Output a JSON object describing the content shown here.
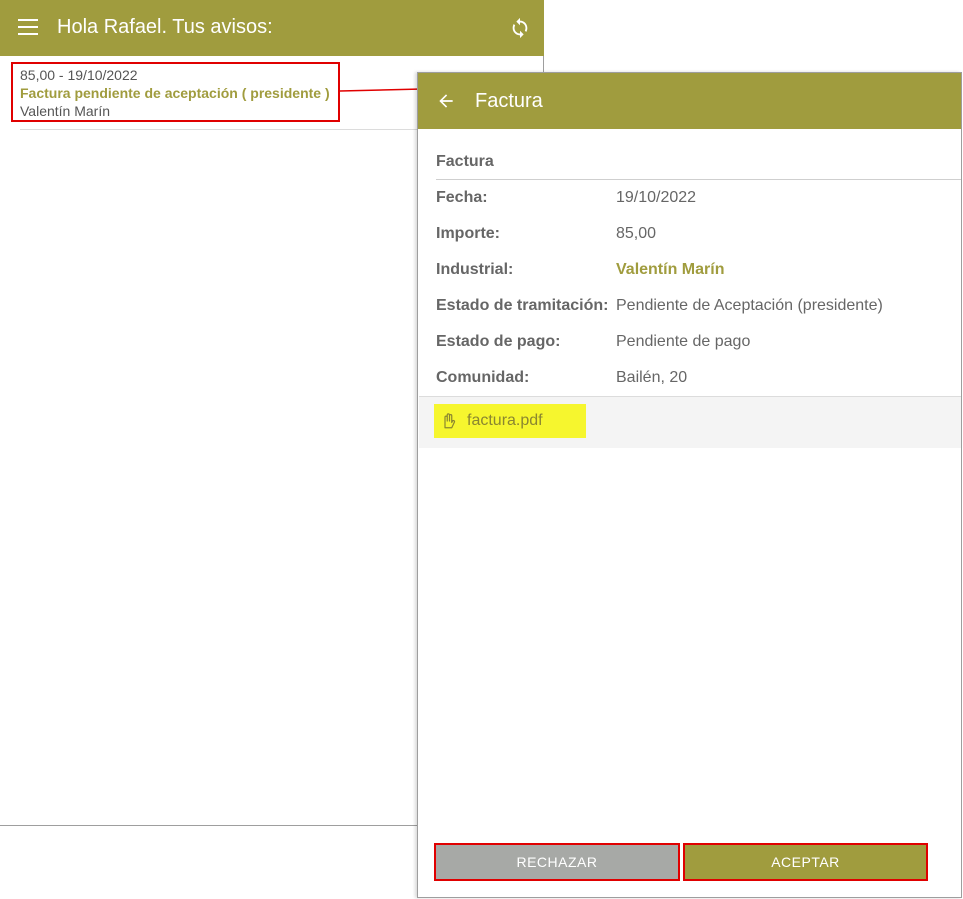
{
  "left_screen": {
    "header": {
      "title": "Hola Rafael. Tus avisos:"
    },
    "notices": [
      {
        "amount_date": "85,00 - 19/10/2022",
        "title": "Factura pendiente de aceptación ( presidente )",
        "person": "Valentín Marín"
      }
    ]
  },
  "right_screen": {
    "header": {
      "title": "Factura"
    },
    "section_title": "Factura",
    "fields": [
      {
        "label": "Fecha:",
        "value": "19/10/2022"
      },
      {
        "label": "Importe:",
        "value": "85,00"
      },
      {
        "label": "Industrial:",
        "value": "Valentín Marín"
      },
      {
        "label": "Estado de tramitación:",
        "value": "Pendiente de Aceptación (presidente)"
      },
      {
        "label": "Estado de pago:",
        "value": "Pendiente de pago"
      },
      {
        "label": "Comunidad:",
        "value": "Bailén, 20"
      }
    ],
    "attachment": {
      "name": "factura.pdf"
    },
    "buttons": {
      "reject": "RECHAZAR",
      "accept": "ACEPTAR"
    }
  },
  "colors": {
    "accent": "#a09c3e",
    "annotation_red": "#e00000",
    "highlight_yellow": "#f6f62e",
    "reject_gray": "#a7a9a6"
  },
  "icons": {
    "menu": "menu-icon",
    "refresh": "refresh-icon",
    "back": "arrow-left-icon",
    "attachment": "hand-icon"
  }
}
